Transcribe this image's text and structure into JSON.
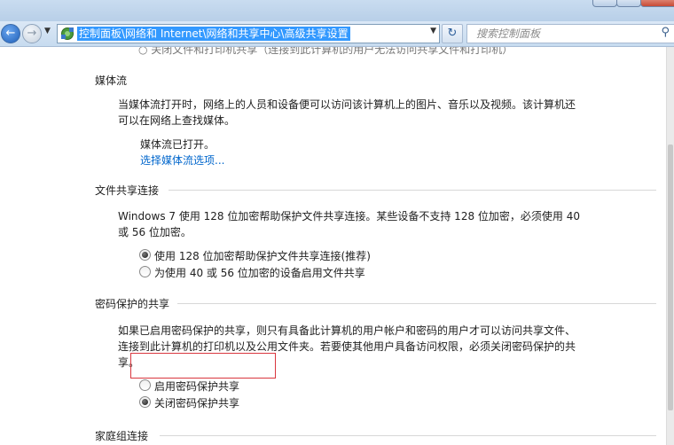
{
  "window": {},
  "nav": {
    "address_text": "控制面板\\网络和 Internet\\网络和共享中心\\高级共享设置",
    "search_placeholder": "搜索控制面板"
  },
  "sections": {
    "cut_off_text": "○ 关闭文件和打印机共享（连接到此计算机的用户无法访问共享文件和打印机）",
    "media": {
      "heading": "媒体流",
      "description": "当媒体流打开时，网络上的人员和设备便可以访问该计算机上的图片、音乐以及视频。该计算机还可以在网络上查找媒体。",
      "status": "媒体流已打开。",
      "options_link": "选择媒体流选项..."
    },
    "file_sharing": {
      "heading": "文件共享连接",
      "description": "Windows 7 使用 128 位加密帮助保护文件共享连接。某些设备不支持 128 位加密，必须使用 40 或 56 位加密。",
      "option_128": "使用 128 位加密帮助保护文件共享连接(推荐)",
      "option_40_56": "为使用 40 或 56 位加密的设备启用文件共享",
      "selected": "option_128"
    },
    "password": {
      "heading": "密码保护的共享",
      "description": "如果已启用密码保护的共享，则只有具备此计算机的用户帐户和密码的用户才可以访问共享文件、连接到此计算机的打印机以及公用文件夹。若要使其他用户具备访问权限，必须关闭密码保护的共享。",
      "option_on": "启用密码保护共享",
      "option_off": "关闭密码保护共享",
      "selected": "option_off"
    },
    "homegroup": {
      "heading": "家庭组连接"
    }
  },
  "colors": {
    "highlight_box": "#d9363e",
    "link": "#0066cc",
    "address_selection": "#3399ff"
  }
}
